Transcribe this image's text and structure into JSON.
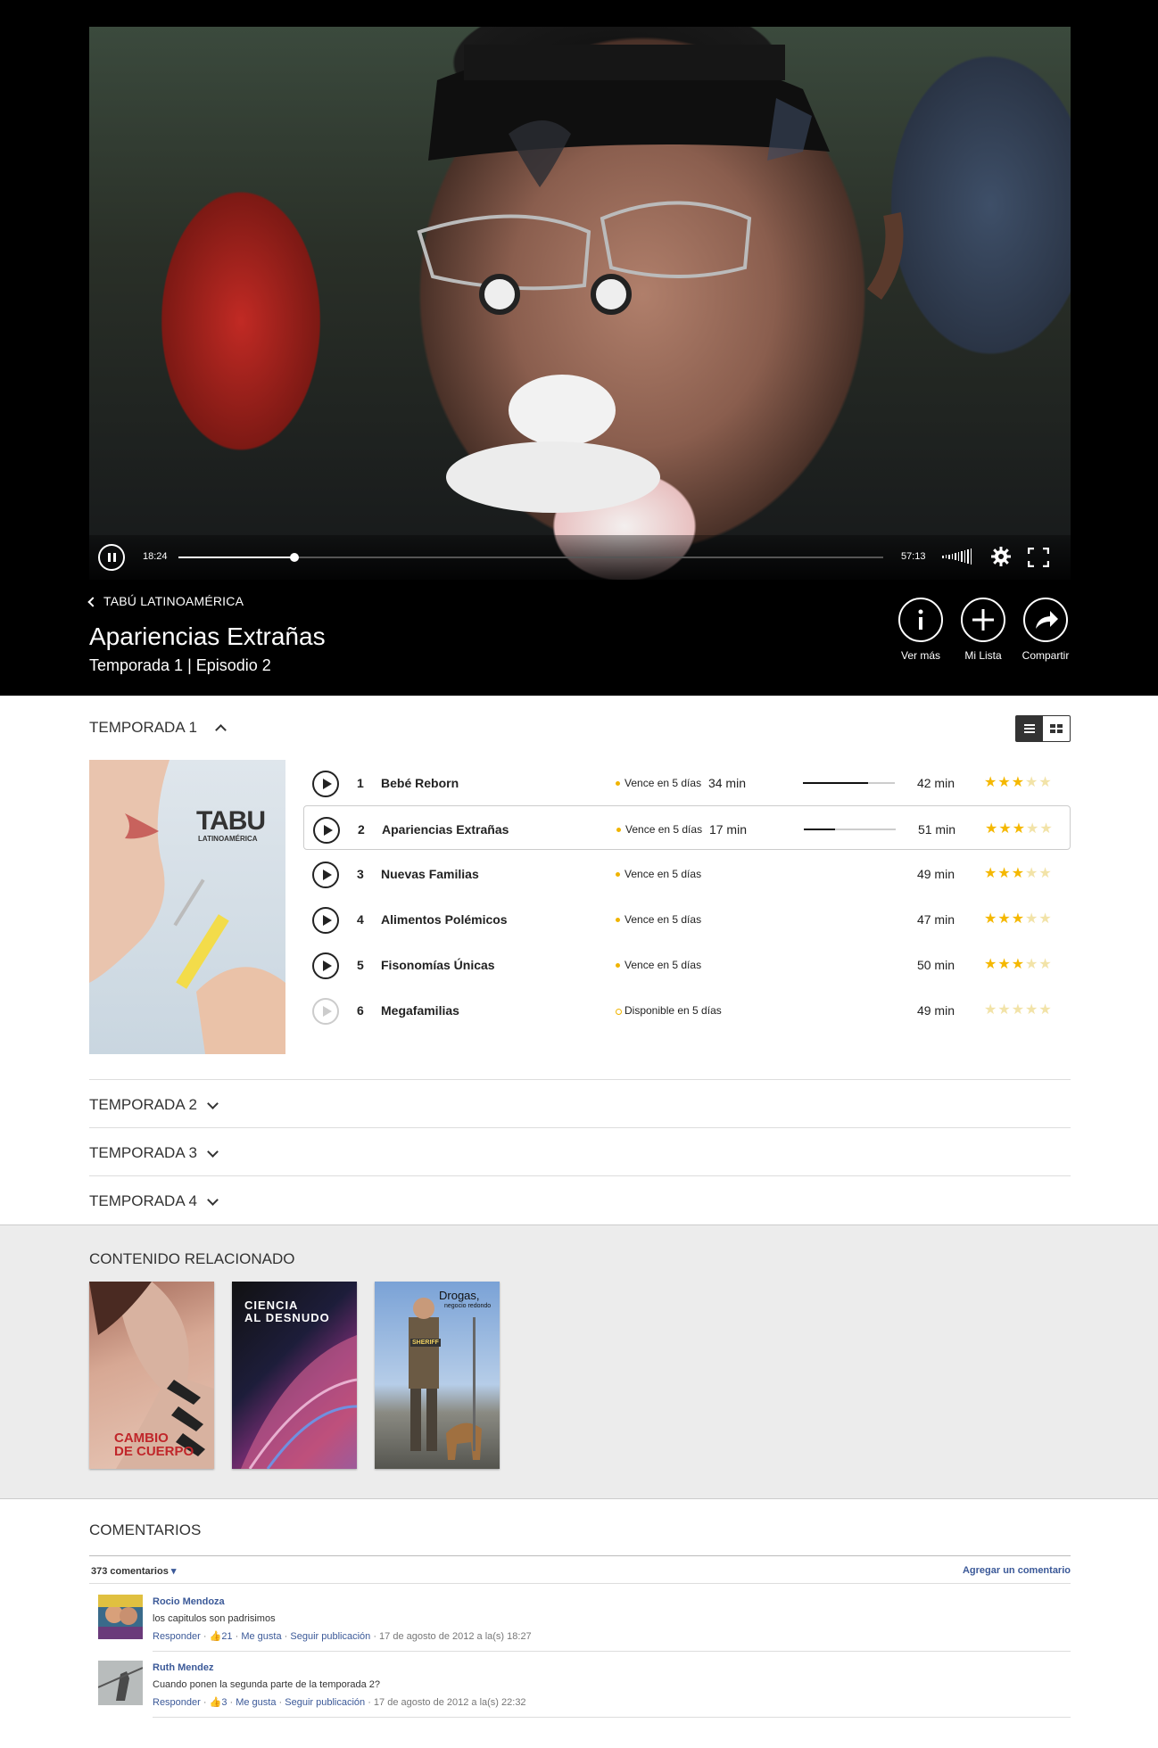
{
  "player": {
    "current_time": "18:24",
    "total_time": "57:13",
    "progress": 0.165
  },
  "header": {
    "back_label": "TABÚ LATINOAMÉRICA",
    "title": "Apariencias Extrañas",
    "subtitle": "Temporada 1 | Episodio 2",
    "actions": [
      {
        "label": "Ver más",
        "icon": "info-icon"
      },
      {
        "label": "Mi Lista",
        "icon": "plus-icon"
      },
      {
        "label": "Compartir",
        "icon": "share-icon"
      }
    ]
  },
  "season": {
    "label": "TEMPORADA 1",
    "poster_brand": "TABU",
    "poster_sub": "LATINOAMÉRICA",
    "episodes": [
      {
        "num": "1",
        "name": "Bebé Reborn",
        "availability": "Vence en 5 días",
        "watched": "34 min",
        "progress": 0.71,
        "duration": "42 min",
        "rating": 3,
        "enabled": true,
        "active": false
      },
      {
        "num": "2",
        "name": "Apariencias Extrañas",
        "availability": "Vence en 5 días",
        "watched": "17 min",
        "progress": 0.34,
        "duration": "51 min",
        "rating": 3,
        "enabled": true,
        "active": true
      },
      {
        "num": "3",
        "name": "Nuevas Familias",
        "availability": "Vence en 5 días",
        "watched": "",
        "progress": null,
        "duration": "49 min",
        "rating": 3,
        "enabled": true,
        "active": false
      },
      {
        "num": "4",
        "name": "Alimentos Polémicos",
        "availability": "Vence en 5 días",
        "watched": "",
        "progress": null,
        "duration": "47 min",
        "rating": 3,
        "enabled": true,
        "active": false
      },
      {
        "num": "5",
        "name": "Fisonomías Únicas",
        "availability": "Vence en 5 días",
        "watched": "",
        "progress": null,
        "duration": "50 min",
        "rating": 3,
        "enabled": true,
        "active": false
      },
      {
        "num": "6",
        "name": "Megafamilias",
        "availability": "Disponible en 5 días",
        "watched": "",
        "progress": null,
        "duration": "49 min",
        "rating": 0,
        "enabled": false,
        "active": false
      }
    ]
  },
  "other_seasons": [
    "TEMPORADA 2",
    "TEMPORADA 3",
    "TEMPORADA 4"
  ],
  "related": {
    "heading": "CONTENIDO RELACIONADO",
    "items": [
      {
        "title_line1": "CAMBIO",
        "title_line2": "DE CUERPO"
      },
      {
        "title_line1": "CIENCIA",
        "title_line2": "AL DESNUDO"
      },
      {
        "title_line1": "Drogas,",
        "title_line2": "negocio redondo",
        "badge": "SHERIFF"
      }
    ]
  },
  "comments": {
    "heading": "COMENTARIOS",
    "count": "373 comentarios",
    "add_label": "Agregar un comentario",
    "items": [
      {
        "author": "Rocio Mendoza",
        "text": "los capitulos son padrisimos",
        "reply": "Responder",
        "likes": "21",
        "like": "Me gusta",
        "follow": "Seguir publicación",
        "date": "17 de agosto de 2012 a la(s) 18:27"
      },
      {
        "author": "Ruth Mendez",
        "text": "Cuando ponen la segunda parte de la temporada 2?",
        "reply": "Responder",
        "likes": "3",
        "like": "Me gusta",
        "follow": "Seguir publicación",
        "date": "17 de agosto de 2012 a la(s) 22:32"
      }
    ]
  },
  "colors": {
    "accent_star": "#f5b800",
    "link": "#3b5998",
    "availability_dot": "#f0b400"
  }
}
